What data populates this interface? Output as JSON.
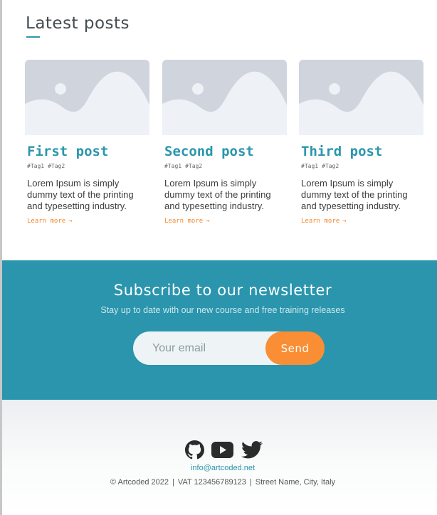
{
  "posts_section": {
    "title": "Latest posts"
  },
  "posts": [
    {
      "title": "First post",
      "tags": [
        "#Tag1",
        "#Tag2"
      ],
      "excerpt": "Lorem Ipsum is simply dummy text of the printing and typesetting industry.",
      "link": "Learn more",
      "arrow": "→",
      "image_icon": "image-placeholder-icon"
    },
    {
      "title": "Second post",
      "tags": [
        "#Tag1",
        "#Tag2"
      ],
      "excerpt": "Lorem Ipsum is simply dummy text of the printing and typesetting industry.",
      "link": "Learn more",
      "arrow": "→",
      "image_icon": "image-placeholder-icon"
    },
    {
      "title": "Third post",
      "tags": [
        "#Tag1",
        "#Tag2"
      ],
      "excerpt": "Lorem Ipsum is simply dummy text of the printing and typesetting industry.",
      "link": "Learn more",
      "arrow": "→",
      "image_icon": "image-placeholder-icon"
    }
  ],
  "newsletter": {
    "title": "Subscribe to our newsletter",
    "subtitle": "Stay up to date with our new course and free training releases",
    "email_placeholder": "Your email",
    "email_value": "",
    "send_label": "Send"
  },
  "footer": {
    "social_icons": [
      "github-icon",
      "youtube-icon",
      "twitter-icon"
    ],
    "email": "info@artcoded.net",
    "copyright": "© Artcoded 2022",
    "vat": "VAT 123456789123",
    "address": "Street Name, City, Italy",
    "separator": "|"
  },
  "colors": {
    "accent": "#2a97ac",
    "newsletter_bg": "#2a95ad",
    "cta": "#f98e35",
    "link": "#f3892e",
    "placeholder_bg": "#cfd4dd",
    "placeholder_fg": "#eef1f5"
  }
}
